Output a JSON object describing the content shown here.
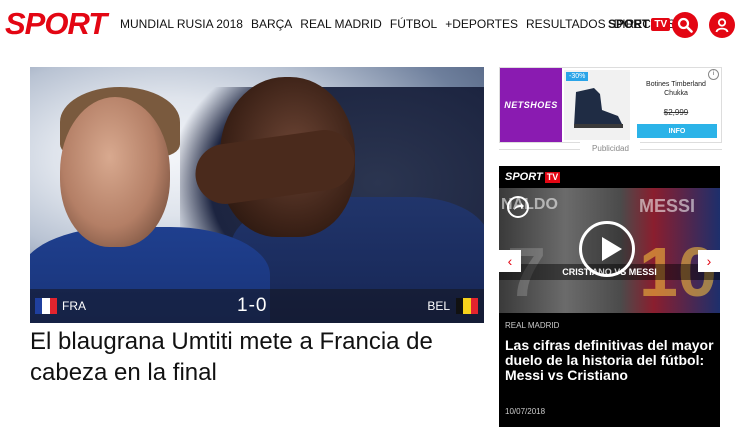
{
  "header": {
    "logo": "SPORT",
    "nav": [
      "MUNDIAL RUSIA 2018",
      "BARÇA",
      "REAL MADRID",
      "FÚTBOL",
      "+DEPORTES",
      "RESULTADOS",
      "DIRECTOS"
    ],
    "sporttv_label": "SPORT",
    "sporttv_tv": "TV",
    "search_icon": "search-icon",
    "user_icon": "user-icon",
    "accent_color": "#e30613"
  },
  "hero": {
    "team_home": "FRA",
    "team_away": "BEL",
    "score": "1-0",
    "headline": "El blaugrana Umtiti mete a Francia de cabeza en la final"
  },
  "ad": {
    "brand": "NETSHOES",
    "discount": "-30%",
    "product": "Botines Timberland Chukka",
    "price": "$2,999",
    "cta": "INFO",
    "info_icon": "i",
    "label": "Publicidad"
  },
  "tv_card": {
    "logo": "SPORT",
    "logo_tv": "TV",
    "video_caption": "CRISTIANO VS MESSI",
    "video_text_left": "NALDO",
    "video_text_right": "MESSI",
    "section": "REAL MADRID",
    "title": "Las cifras definitivas del mayor duelo de la historia del fútbol: Messi vs Cristiano",
    "date": "10/07/2018"
  }
}
